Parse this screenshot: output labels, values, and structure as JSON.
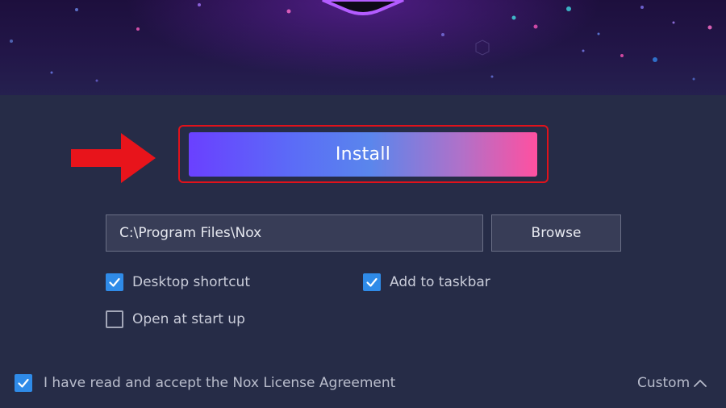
{
  "install": {
    "label": "Install"
  },
  "path": {
    "value": "C:\\Program Files\\Nox"
  },
  "browse": {
    "label": "Browse"
  },
  "options": {
    "desktop_shortcut": {
      "label": "Desktop shortcut",
      "checked": true
    },
    "add_to_taskbar": {
      "label": "Add to taskbar",
      "checked": true
    },
    "open_at_startup": {
      "label": "Open at start up",
      "checked": false
    }
  },
  "license": {
    "label": "I have read and accept the Nox License Agreement",
    "checked": true
  },
  "custom": {
    "label": "Custom"
  },
  "colors": {
    "accent_checkbox": "#2f8be8",
    "highlight_frame": "#e0121b",
    "arrow": "#e8141b",
    "background": "#262c47"
  },
  "icons": {
    "check": "check-icon",
    "arrow": "red-arrow-icon",
    "chevron": "chevron-up-icon"
  }
}
